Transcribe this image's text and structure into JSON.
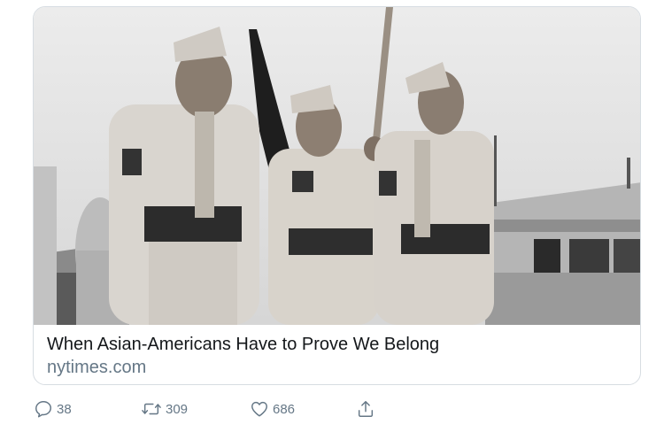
{
  "card": {
    "image_alt": "Black and white photo of three uniformed soldiers, one holding a flag pole",
    "title": "When Asian-Americans Have to Prove We Belong",
    "domain": "nytimes.com"
  },
  "actions": {
    "reply_count": "38",
    "retweet_count": "309",
    "like_count": "686"
  },
  "colors": {
    "text_primary": "#14171a",
    "text_secondary": "#657786",
    "card_border": "#d7dde2"
  },
  "icons": [
    "reply-icon",
    "retweet-icon",
    "like-icon",
    "share-icon"
  ]
}
